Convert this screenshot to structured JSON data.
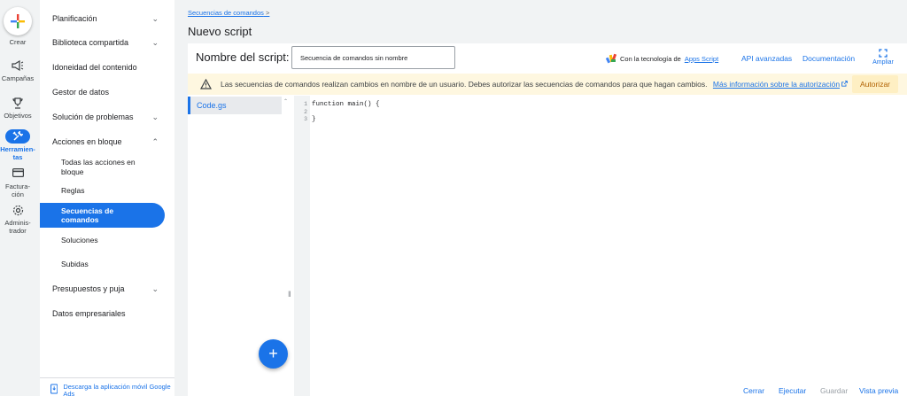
{
  "rail": {
    "create_label": "Crear",
    "items": [
      {
        "label": "Campañas",
        "icon": "megaphone-icon"
      },
      {
        "label": "Objetivos",
        "icon": "trophy-icon"
      },
      {
        "label": "Herramien-\ntas",
        "icon": "tools-icon"
      },
      {
        "label": "Factura-\nción",
        "icon": "credit-card-icon"
      },
      {
        "label": "Adminis-\ntrador",
        "icon": "gear-icon"
      }
    ]
  },
  "nav": {
    "items": [
      {
        "label": "Planificación",
        "expandable": true
      },
      {
        "label": "Biblioteca compartida",
        "expandable": true
      },
      {
        "label": "Idoneidad del contenido",
        "expandable": false
      },
      {
        "label": "Gestor de datos",
        "expandable": false
      },
      {
        "label": "Solución de problemas",
        "expandable": true
      },
      {
        "label": "Acciones en bloque",
        "expandable": true,
        "expanded": true
      },
      {
        "label": "Todas las acciones en bloque",
        "sub": true
      },
      {
        "label": "Reglas",
        "sub": true
      },
      {
        "label": "Secuencias de comandos",
        "sub": true,
        "active": true
      },
      {
        "label": "Soluciones",
        "sub": true
      },
      {
        "label": "Subidas",
        "sub": true
      },
      {
        "label": "Presupuestos y puja",
        "expandable": true
      },
      {
        "label": "Datos empresariales",
        "expandable": false
      }
    ],
    "download_label": "Descarga la aplicación móvil Google Ads"
  },
  "breadcrumb": {
    "link": "Secuencias de comandos",
    "sep": ">"
  },
  "page_title": "Nuevo script",
  "script_name": {
    "label": "Nombre del script:",
    "value": "Secuencia de comandos sin nombre"
  },
  "powered": {
    "prefix": "Con la tecnología de",
    "link": "Apps Script"
  },
  "toplinks": {
    "advanced": "API avanzadas",
    "docs": "Documentación",
    "expand": "Ampliar"
  },
  "banner": {
    "text": "Las secuencias de comandos realizan cambios en nombre de un usuario. Debes autorizar las secuencias de comandos para que hagan cambios.",
    "link": "Más información sobre la autorización",
    "button": "Autorizar"
  },
  "files": [
    {
      "name": "Code.gs"
    }
  ],
  "code": {
    "line_numbers": [
      "1",
      "2",
      "3"
    ],
    "lines": [
      "function main() {",
      "",
      "}"
    ]
  },
  "actions": {
    "close": "Cerrar",
    "run": "Ejecutar",
    "save": "Guardar",
    "preview": "Vista previa"
  },
  "colors": {
    "accent": "#1a73e8",
    "warning_bg": "#fef7e0",
    "warning_text": "#b06000"
  }
}
